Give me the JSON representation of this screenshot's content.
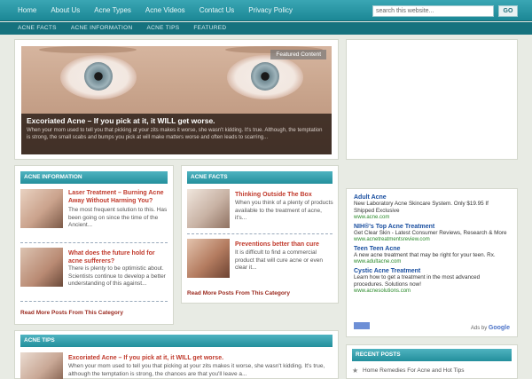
{
  "nav": {
    "links": [
      "Home",
      "About Us",
      "Acne Types",
      "Acne Videos",
      "Contact Us",
      "Privacy Policy"
    ],
    "search_placeholder": "search this website...",
    "go_label": "GO"
  },
  "subnav": [
    "ACNE FACTS",
    "ACNE INFORMATION",
    "ACNE TIPS",
    "FEATURED"
  ],
  "featured": {
    "label": "Featured Content",
    "title": "Excoriated Acne – If you pick at it, it WILL get worse.",
    "text": "When your mom used to tell you that picking at your zits makes it worse, she wasn't kidding. It's true. Although, the temptation is strong, the small scabs and bumps you pick at will make matters worse and often leads to scarring..."
  },
  "acne_info": {
    "heading": "ACNE INFORMATION",
    "posts": [
      {
        "title": "Laser Treatment – Burning Acne Away Without Harming You?",
        "text": "The most frequent solution to this. Has been going on since the time of the Ancient..."
      },
      {
        "title": "What does the future hold for acne sufferers?",
        "text": "There is plenty to be optimistic about. Scientists continue to develop a better understanding of this against..."
      }
    ],
    "more": "Read More Posts From This Category"
  },
  "acne_facts": {
    "heading": "ACNE FACTS",
    "posts": [
      {
        "title": "Thinking Outside The Box",
        "text": "When you think of a plenty of products available to the treatment of acne, it's..."
      },
      {
        "title": "Preventions better than cure",
        "text": "It is difficult to find a commercial product that will cure acne or even clear it..."
      }
    ],
    "more": "Read More Posts From This Category"
  },
  "acne_tips": {
    "heading": "ACNE TIPS",
    "post": {
      "title": "Excoriated Acne – If you pick at it, it WILL get worse.",
      "text": "When your mom used to tell you that picking at your zits makes it worse, she wasn't kidding. It's true, although the temptation is strong, the chances are that you'll leave a..."
    }
  },
  "ads": [
    {
      "title": "Adult Acne",
      "text": "New Laboratory Acne Skincare System. Only $19.95 If Shipped Exclusive",
      "url": "www.acne.com"
    },
    {
      "title": "NIH®'s Top Acne Treatment",
      "text": "Get Clear Skin - Latest Consumer Reviews, Research & More",
      "url": "www.acnetreatmentsreview.com"
    },
    {
      "title": "Teen Teen Acne",
      "text": "A new acne treatment that may be right for your teen. Rx.",
      "url": "www.adultacne.com"
    },
    {
      "title": "Cystic Acne Treatment",
      "text": "Learn how to get a treatment in the most advanced procedures. Solutions now!",
      "url": "www.acnesolutions.com"
    }
  ],
  "ads_by": "Ads by",
  "ads_brand": "Google",
  "recent": {
    "heading": "RECENT POSTS",
    "first": "Home Remedies For Acne and Hot Tips"
  }
}
